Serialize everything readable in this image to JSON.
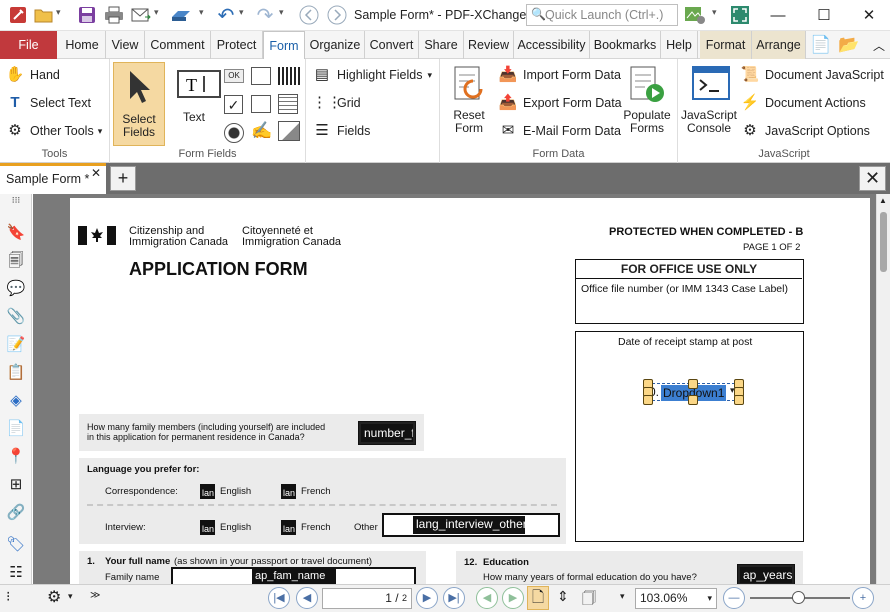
{
  "window": {
    "title": "Sample Form* - PDF-XChange ...",
    "quick_launch_placeholder": "Quick Launch (Ctrl+.)"
  },
  "menu": {
    "file": "File",
    "tabs": [
      "Home",
      "View",
      "Comment",
      "Protect",
      "Form",
      "Organize",
      "Convert",
      "Share",
      "Review",
      "Accessibility",
      "Bookmarks",
      "Help",
      "Format",
      "Arrange"
    ]
  },
  "ribbon": {
    "tools": {
      "hand": "Hand",
      "select_text": "Select Text",
      "other_tools": "Other Tools",
      "label": "Tools"
    },
    "form_fields": {
      "select_fields": "Select\nFields",
      "select_fields_l1": "Select",
      "select_fields_l2": "Fields",
      "text": "Text",
      "label": "Form Fields",
      "ok": "OK"
    },
    "highlight": {
      "highlight_fields": "Highlight Fields",
      "grid": "Grid",
      "fields": "Fields"
    },
    "form_data": {
      "reset_l1": "Reset",
      "reset_l2": "Form",
      "import": "Import Form Data",
      "export": "Export Form Data",
      "email": "E-Mail Form Data",
      "populate_l1": "Populate",
      "populate_l2": "Forms",
      "label": "Form Data"
    },
    "javascript": {
      "console_l1": "JavaScript",
      "console_l2": "Console",
      "doc_js": "Document JavaScript",
      "doc_actions": "Document Actions",
      "js_options": "JavaScript Options",
      "label": "JavaScript"
    }
  },
  "doc_tab": {
    "name": "Sample Form *"
  },
  "pdf": {
    "agency_en_1": "Citizenship and",
    "agency_en_2": "Immigration Canada",
    "agency_fr_1": "Citoyenneté et",
    "agency_fr_2": "Immigration Canada",
    "protected": "PROTECTED WHEN COMPLETED - B",
    "page_of": "PAGE 1 OF 2",
    "app_form": "APPLICATION FORM",
    "office_use": "FOR OFFICE USE ONLY",
    "office_file": "Office file number (or IMM 1343 Case Label)",
    "date_receipt": "Date of receipt stamp at post",
    "dropdown": "Dropdown1",
    "dropdown_prefix": "0.",
    "family_q1": "How many family members (including yourself) are included",
    "family_q2": "in this application for permanent residence in Canada?",
    "number_field": "number_f",
    "lang_pref": "Language you prefer for:",
    "correspondence": "Correspondence:",
    "english": "English",
    "french": "French",
    "interview": "Interview:",
    "other": "Other",
    "chk_text": "lan",
    "lang_other_field": "lang_interview_other",
    "q1_num": "1.",
    "q1_title": "Your full name",
    "q1_note": "(as shown in your passport or travel document)",
    "family_name": "Family name",
    "fam_field": "ap_fam_name",
    "q12_num": "12.",
    "q12_title": "Education",
    "q12_q": "How many years of formal education do you have?",
    "years_field": "ap_years"
  },
  "status": {
    "page_current": "1",
    "page_total": "2",
    "zoom": "103.06%"
  }
}
